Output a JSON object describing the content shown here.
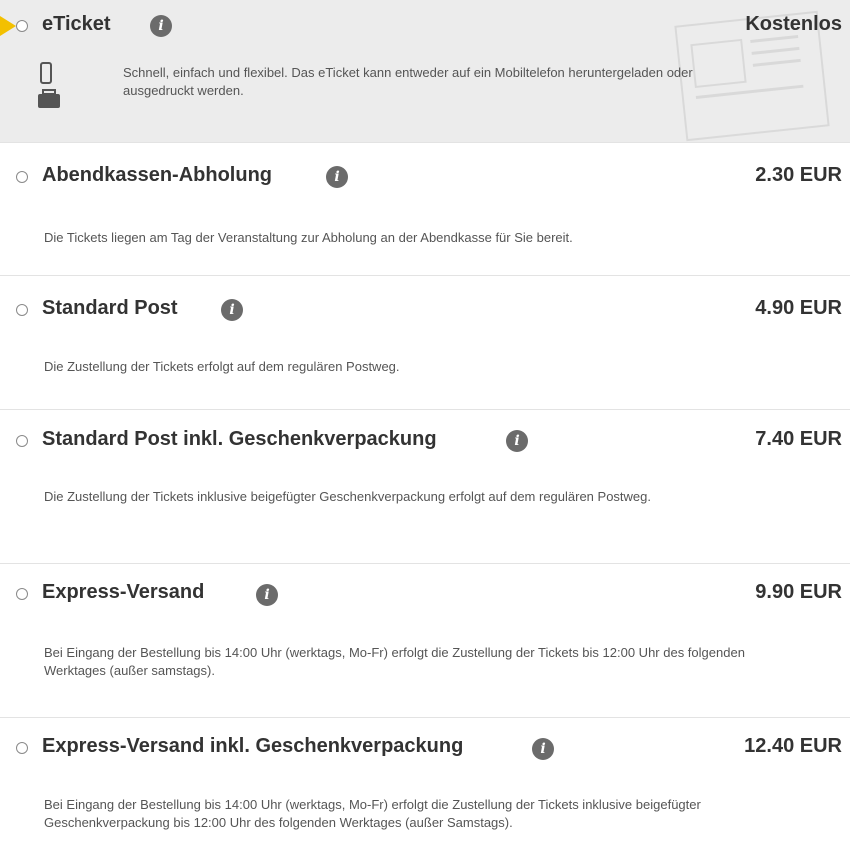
{
  "options": [
    {
      "title": "eTicket",
      "price": "Kostenlos",
      "description": "Schnell, einfach und flexibel. Das eTicket kann entweder auf ein Mobiltelefon heruntergeladen oder ausgedruckt werden.",
      "selected": true
    },
    {
      "title": "Abendkassen-Abholung",
      "price": "2.30 EUR",
      "description": "Die Tickets liegen am Tag der Veranstaltung zur Abholung an der Abendkasse für Sie bereit."
    },
    {
      "title": "Standard Post",
      "price": "4.90 EUR",
      "description": "Die Zustellung der Tickets erfolgt auf dem regulären Postweg."
    },
    {
      "title": "Standard Post inkl. Geschenkverpackung",
      "price": "7.40 EUR",
      "description": "Die Zustellung der Tickets inklusive beigefügter Geschenkverpackung erfolgt auf dem regulären Postweg."
    },
    {
      "title": "Express-Versand",
      "price": "9.90 EUR",
      "description": "Bei Eingang der Bestellung bis 14:00 Uhr (werktags, Mo-Fr) erfolgt die Zustellung der Tickets bis 12:00 Uhr des folgenden Werktages (außer samstags)."
    },
    {
      "title": "Express-Versand inkl. Geschenkverpackung",
      "price": "12.40 EUR",
      "description": "Bei Eingang der Bestellung bis 14:00 Uhr (werktags, Mo-Fr) erfolgt die Zustellung der Tickets inklusive beigefügter Geschenkverpackung bis 12:00 Uhr des folgenden Werktages (außer Samstags)."
    }
  ],
  "icons": {
    "info": "i",
    "selected_marker_color": "#f3c000",
    "selected_background": "#ececec"
  }
}
